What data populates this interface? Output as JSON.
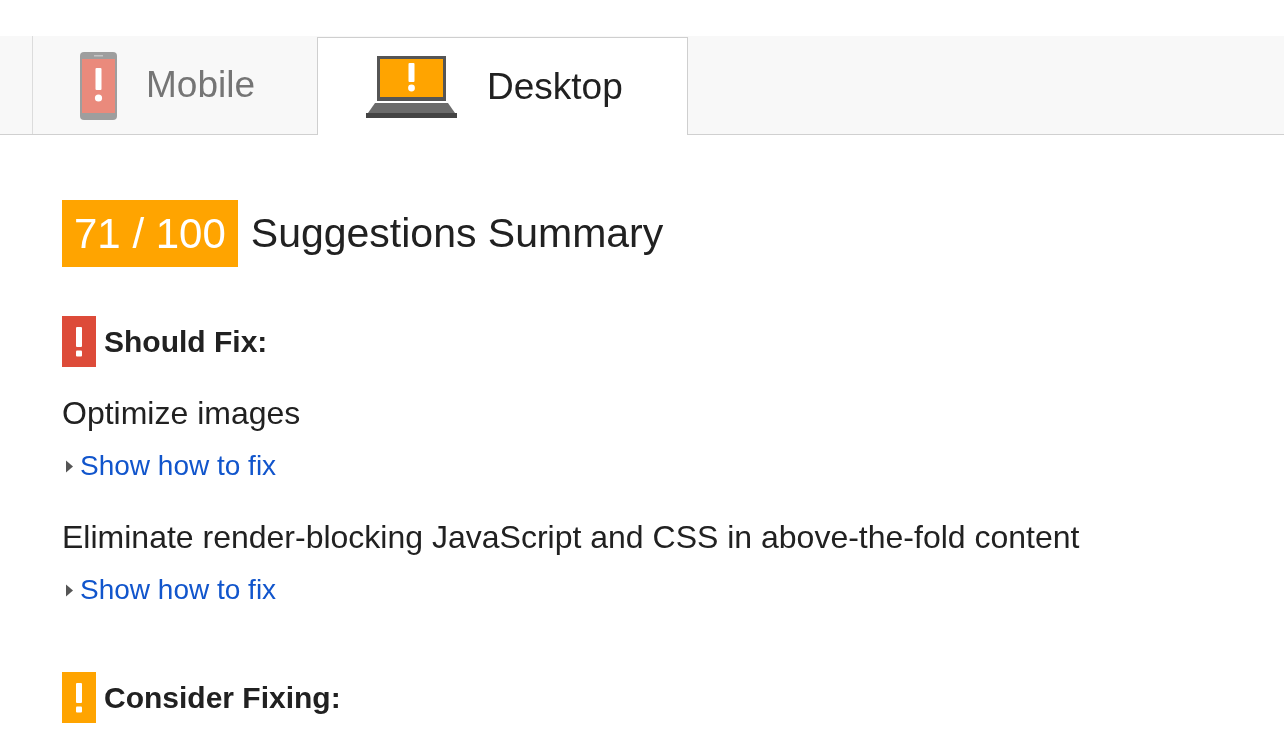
{
  "tabs": [
    {
      "label": "Mobile",
      "kind": "phone",
      "color": "#ea8a7c",
      "selected": false
    },
    {
      "label": "Desktop",
      "kind": "laptop",
      "color": "#ffa400",
      "selected": true
    }
  ],
  "summary": {
    "score": "71 / 100",
    "title": "Suggestions Summary"
  },
  "sections": [
    {
      "heading": "Should Fix:",
      "color": "#dd4b39",
      "rules": [
        {
          "title": "Optimize images",
          "link": "Show how to fix",
          "expanded": false
        },
        {
          "title": "Eliminate render-blocking JavaScript and CSS in above-the-fold content",
          "link": "Show how to fix",
          "expanded": false
        }
      ]
    },
    {
      "heading": "Consider Fixing:",
      "color": "#ffa400"
    }
  ]
}
